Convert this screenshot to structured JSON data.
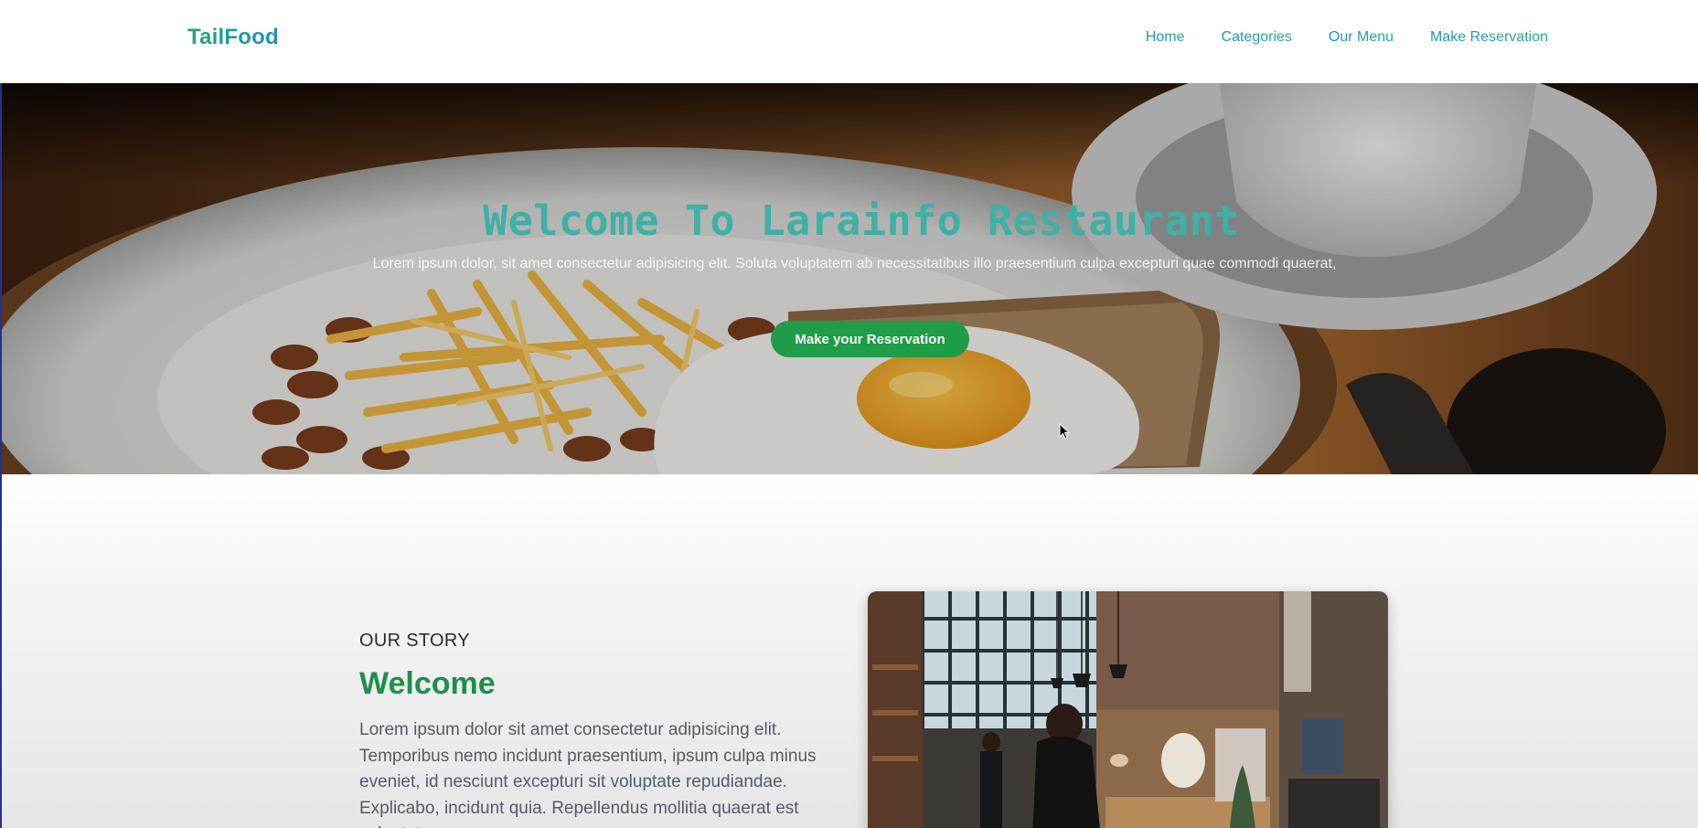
{
  "navbar": {
    "brand": "TailFood",
    "links": [
      {
        "label": "Home"
      },
      {
        "label": "Categories"
      },
      {
        "label": "Our Menu"
      },
      {
        "label": "Make Reservation"
      }
    ]
  },
  "hero": {
    "title": "Welcome To Larainfo Restaurant",
    "subtitle": "Lorem ipsum dolor, sit amet consectetur adipisicing elit. Soluta voluptatem ab necessitatibus illo praesentium culpa excepturi quae commodi quaerat,",
    "button_label": "Make your Reservation"
  },
  "story": {
    "eyebrow": "OUR STORY",
    "heading": "Welcome",
    "text": "Lorem ipsum dolor sit amet consectetur adipisicing elit. Temporibus nemo incidunt praesentium, ipsum culpa minus eveniet, id nesciunt excepturi sit voluptate repudiandae. Explicabo, incidunt quia. Repellendus mollitia quaerat est voluptatum."
  },
  "colors": {
    "brand_gradient": [
      "#22a86b",
      "#1f8fc9"
    ],
    "hero_title": "#3fb0a6",
    "cta_button": "#1e9c47",
    "story_heading": "#1d8f4a"
  },
  "icons": {
    "cursor": "mouse-pointer-icon"
  }
}
